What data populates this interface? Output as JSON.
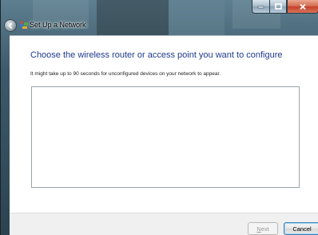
{
  "window": {
    "title": "Set Up a Network"
  },
  "page": {
    "heading": "Choose the wireless router or access point you want to configure",
    "subtext": "It might take up to 90 seconds for unconfigured devices on your network to appear."
  },
  "device_list": {
    "items": []
  },
  "buttons": {
    "next_first": "N",
    "next_rest": "ext",
    "cancel": "Cancel"
  },
  "colors": {
    "heading": "#1e3a8c",
    "close_button": "#c4402a",
    "glass": "#3d5a6a"
  },
  "icons": {
    "back": "back-arrow-icon",
    "app": "network-setup-icon",
    "minimize": "minimize-icon",
    "maximize": "maximize-icon",
    "close": "close-icon"
  }
}
